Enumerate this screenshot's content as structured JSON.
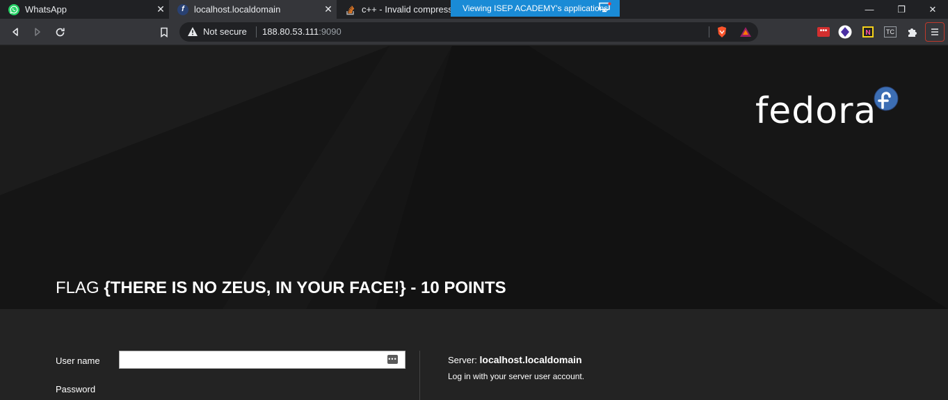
{
  "tabs": [
    {
      "title": "WhatsApp",
      "icon": "whatsapp-icon",
      "active": false
    },
    {
      "title": "localhost.localdomain",
      "icon": "fedora-favicon-icon",
      "active": true
    },
    {
      "title": "c++ - Invalid compressed",
      "icon": "stackoverflow-icon",
      "active": false
    }
  ],
  "close_glyph": "✕",
  "share_banner": {
    "text": "Viewing ISEP ACADEMY's applications"
  },
  "window_controls": {
    "minimize": "—",
    "restore": "❐",
    "close": "✕"
  },
  "address_bar": {
    "security_label": "Not secure",
    "url_host": "188.80.53.111",
    "url_port": ":9090"
  },
  "page": {
    "brand_wordmark": "fedora",
    "flag_prefix": "FLAG ",
    "flag_text": "{THERE IS NO ZEUS, IN YOUR FACE!} - 10 POINTS",
    "login": {
      "username_label": "User name",
      "password_label": "Password",
      "username_value": "",
      "server_label": "Server: ",
      "server_name": "localhost.localdomain",
      "hint": "Log in with your server user account."
    }
  },
  "colors": {
    "share_banner": "#1a8bd6",
    "page_bg": "#141414",
    "login_bg": "#232323",
    "fedora_blue": "#3c6eb4"
  }
}
